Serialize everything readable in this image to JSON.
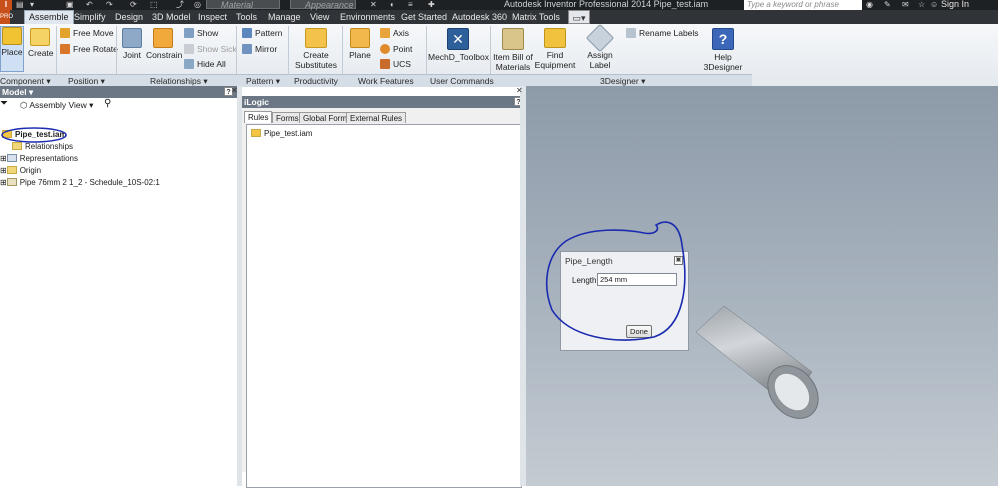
{
  "window": {
    "title": "Autodesk Inventor Professional 2014    Pipe_test.iam",
    "material_placeholder": "Material",
    "appearance_placeholder": "Appearance",
    "search_placeholder": "Type a keyword or phrase",
    "sign_in": "Sign In"
  },
  "tabs": [
    "Assemble",
    "Simplify",
    "Design",
    "3D Model",
    "Inspect",
    "Tools",
    "Manage",
    "View",
    "Environments",
    "Get Started",
    "Autodesk 360",
    "Matrix Tools"
  ],
  "ribbon": {
    "place": "Place",
    "create": "Create",
    "free_move": "Free Move",
    "free_rotate": "Free Rotate",
    "joint": "Joint",
    "constrain": "Constrain",
    "show": "Show",
    "show_sick": "Show Sick",
    "hide_all": "Hide All",
    "pattern": "Pattern",
    "mirror": "Mirror",
    "create_substitutes_1": "Create",
    "create_substitutes_2": "Substitutes",
    "plane": "Plane",
    "axis": "Axis",
    "point": "Point",
    "ucs": "UCS",
    "mechd_toolbox": "MechD_Toolbox",
    "item_bill_1": "Item Bill of",
    "item_bill_2": "Materials",
    "find_equipment_1": "Find",
    "find_equipment_2": "Equipment",
    "assign_label": "Assign Label",
    "rename_labels": "Rename Labels",
    "help_3designer": "Help 3Designer"
  },
  "groups": [
    "Component",
    "Position",
    "Relationships",
    "Pattern",
    "Productivity",
    "Work Features",
    "User Commands",
    "3Designer"
  ],
  "model_panel": {
    "title": "Model",
    "view": "Assembly View",
    "tree": [
      "Pipe_test.iam",
      "Relationships",
      "Representations",
      "Origin",
      "Pipe 76mm 2 1_2 - Schedule_10S-02:1"
    ]
  },
  "ilogic": {
    "title": "iLogic",
    "tabs": [
      "Rules",
      "Forms",
      "Global Forms",
      "External Rules"
    ],
    "items": [
      "Pipe_test.iam"
    ]
  },
  "dialog": {
    "title": "Pipe_Length",
    "label": "Length",
    "value": "254 mm",
    "done": "Done"
  }
}
